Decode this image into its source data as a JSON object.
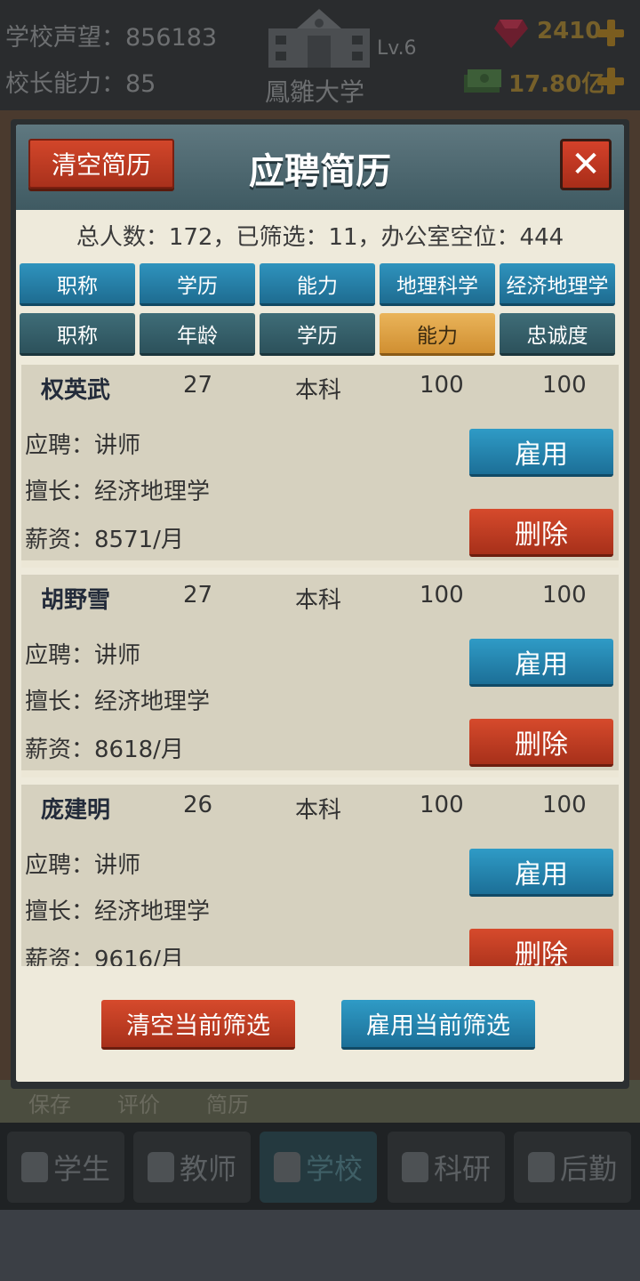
{
  "header": {
    "reputation": "学校声望：856183",
    "principal_ability": "校长能力：85",
    "level": "Lv.6",
    "school_name": "鳳雛大学",
    "gems": "2410",
    "money": "17.80亿"
  },
  "background_links": [
    "保存",
    "评价",
    "简历"
  ],
  "nav": {
    "tabs": [
      {
        "label": "学生",
        "icon": "student-icon"
      },
      {
        "label": "教师",
        "icon": "teacher-icon"
      },
      {
        "label": "学校",
        "icon": "school-icon"
      },
      {
        "label": "科研",
        "icon": "research-icon"
      },
      {
        "label": "后勤",
        "icon": "logistics-icon"
      }
    ],
    "active": "学校"
  },
  "modal": {
    "title": "应聘简历",
    "clear_label": "清空简历",
    "close_glyph": "✕",
    "summary": "总人数：172，已筛选：11，办公室空位：444",
    "filters_row1": [
      "职称",
      "学历",
      "能力",
      "地理科学",
      "经济地理学"
    ],
    "sort_row2": [
      "职称",
      "年龄",
      "学历",
      "能力",
      "忠诚度"
    ],
    "sort_selected": "能力",
    "candidates": [
      {
        "name": "权英武",
        "age": "27",
        "edu": "本科",
        "ability": "100",
        "loyalty": "100",
        "apply": "应聘：讲师",
        "skill": "擅长：经济地理学",
        "salary": "薪资：8571/月"
      },
      {
        "name": "胡野雪",
        "age": "27",
        "edu": "本科",
        "ability": "100",
        "loyalty": "100",
        "apply": "应聘：讲师",
        "skill": "擅长：经济地理学",
        "salary": "薪资：8618/月"
      },
      {
        "name": "庞建明",
        "age": "26",
        "edu": "本科",
        "ability": "100",
        "loyalty": "100",
        "apply": "应聘：讲师",
        "skill": "擅长：经济地理学",
        "salary": "薪资：9616/月"
      }
    ],
    "hire_label": "雇用",
    "delete_label": "删除",
    "clear_filter_label": "清空当前筛选",
    "hire_filter_label": "雇用当前筛选"
  },
  "colors": {
    "accent_blue": "#2f93bd",
    "accent_red": "#d2462a",
    "selected_orange": "#eab45a"
  }
}
